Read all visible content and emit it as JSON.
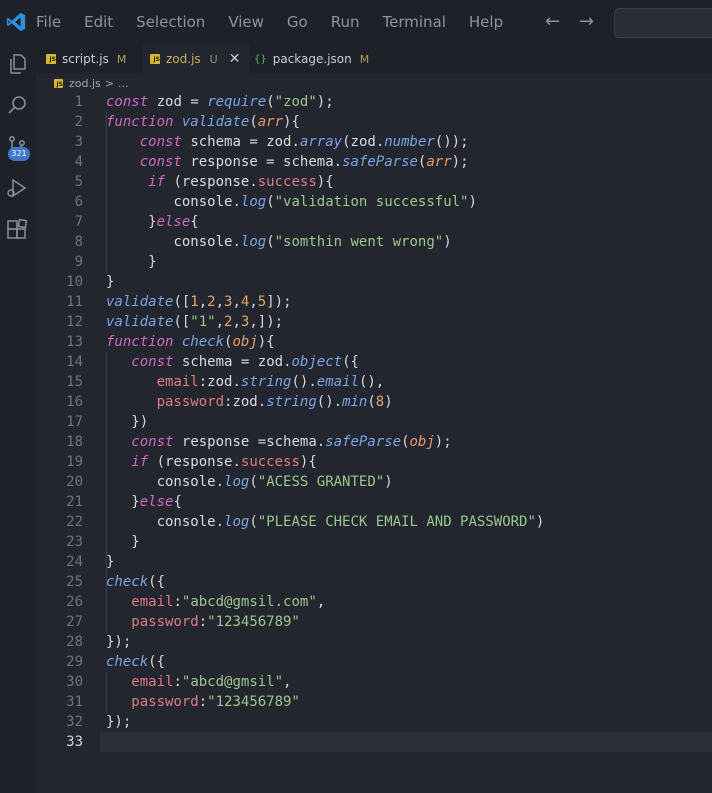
{
  "menu": [
    "File",
    "Edit",
    "Selection",
    "View",
    "Go",
    "Run",
    "Terminal",
    "Help"
  ],
  "tabs": [
    {
      "name": "script.js",
      "status": "M"
    },
    {
      "name": "zod.js",
      "status": "U",
      "active": true
    },
    {
      "name": "package.json",
      "status": "M"
    }
  ],
  "icons": {
    "tab_js": "JS",
    "tab_package": "{}"
  },
  "breadcrumb": {
    "file": "zod.js",
    "sep": ">",
    "rest": "..."
  },
  "source_control_badge": "321",
  "current_line": 33,
  "lines": [
    [
      [
        "k",
        "const"
      ],
      [
        "pn",
        " "
      ],
      [
        "id",
        "zod"
      ],
      [
        "pn",
        " = "
      ],
      [
        "fn",
        "require"
      ],
      [
        "pn",
        "("
      ],
      [
        "str",
        "\"zod\""
      ],
      [
        "pn",
        ");"
      ]
    ],
    [
      [
        "k",
        "function"
      ],
      [
        "pn",
        " "
      ],
      [
        "fn",
        "validate"
      ],
      [
        "pn",
        "("
      ],
      [
        "pm",
        "arr"
      ],
      [
        "pn",
        "){"
      ]
    ],
    [
      [
        "pn",
        "    "
      ],
      [
        "k",
        "const"
      ],
      [
        "pn",
        " "
      ],
      [
        "id",
        "schema"
      ],
      [
        "pn",
        " = "
      ],
      [
        "id",
        "zod"
      ],
      [
        "pn",
        "."
      ],
      [
        "fn",
        "array"
      ],
      [
        "pn",
        "("
      ],
      [
        "id",
        "zod"
      ],
      [
        "pn",
        "."
      ],
      [
        "fn",
        "number"
      ],
      [
        "pn",
        "());"
      ]
    ],
    [
      [
        "pn",
        "    "
      ],
      [
        "k",
        "const"
      ],
      [
        "pn",
        " "
      ],
      [
        "id",
        "response"
      ],
      [
        "pn",
        " = "
      ],
      [
        "id",
        "schema"
      ],
      [
        "pn",
        "."
      ],
      [
        "fn",
        "safeParse"
      ],
      [
        "pn",
        "("
      ],
      [
        "pm",
        "arr"
      ],
      [
        "pn",
        ");"
      ]
    ],
    [
      [
        "pn",
        "     "
      ],
      [
        "k",
        "if"
      ],
      [
        "pn",
        " ("
      ],
      [
        "id",
        "response"
      ],
      [
        "pn",
        "."
      ],
      [
        "prop",
        "success"
      ],
      [
        "pn",
        "){"
      ]
    ],
    [
      [
        "pn",
        "        "
      ],
      [
        "id",
        "console"
      ],
      [
        "pn",
        "."
      ],
      [
        "fn",
        "log"
      ],
      [
        "pn",
        "("
      ],
      [
        "str",
        "\"validation successful\""
      ],
      [
        "pn",
        ")"
      ]
    ],
    [
      [
        "pn",
        "     }"
      ],
      [
        "k",
        "else"
      ],
      [
        "pn",
        "{"
      ]
    ],
    [
      [
        "pn",
        "        "
      ],
      [
        "id",
        "console"
      ],
      [
        "pn",
        "."
      ],
      [
        "fn",
        "log"
      ],
      [
        "pn",
        "("
      ],
      [
        "str",
        "\"somthin went wrong\""
      ],
      [
        "pn",
        ")"
      ]
    ],
    [
      [
        "pn",
        "     }"
      ]
    ],
    [
      [
        "pn",
        "}"
      ]
    ],
    [
      [
        "fn",
        "validate"
      ],
      [
        "pn",
        "(["
      ],
      [
        "num",
        "1"
      ],
      [
        "pn",
        ","
      ],
      [
        "num",
        "2"
      ],
      [
        "pn",
        ","
      ],
      [
        "num",
        "3"
      ],
      [
        "pn",
        ","
      ],
      [
        "num",
        "4"
      ],
      [
        "pn",
        ","
      ],
      [
        "num",
        "5"
      ],
      [
        "pn",
        "]);"
      ]
    ],
    [
      [
        "fn",
        "validate"
      ],
      [
        "pn",
        "(["
      ],
      [
        "str",
        "\"1\""
      ],
      [
        "pn",
        ","
      ],
      [
        "num",
        "2"
      ],
      [
        "pn",
        ","
      ],
      [
        "num",
        "3"
      ],
      [
        "pn",
        ",]);"
      ]
    ],
    [
      [
        "k",
        "function"
      ],
      [
        "pn",
        " "
      ],
      [
        "fn",
        "check"
      ],
      [
        "pn",
        "("
      ],
      [
        "pm",
        "obj"
      ],
      [
        "pn",
        "){"
      ]
    ],
    [
      [
        "pn",
        "   "
      ],
      [
        "k",
        "const"
      ],
      [
        "pn",
        " "
      ],
      [
        "id",
        "schema"
      ],
      [
        "pn",
        " = "
      ],
      [
        "id",
        "zod"
      ],
      [
        "pn",
        "."
      ],
      [
        "fn",
        "object"
      ],
      [
        "pn",
        "({"
      ]
    ],
    [
      [
        "pn",
        "      "
      ],
      [
        "prop",
        "email"
      ],
      [
        "pn",
        ":"
      ],
      [
        "id",
        "zod"
      ],
      [
        "pn",
        "."
      ],
      [
        "fn",
        "string"
      ],
      [
        "pn",
        "()."
      ],
      [
        "fn",
        "email"
      ],
      [
        "pn",
        "(),"
      ]
    ],
    [
      [
        "pn",
        "      "
      ],
      [
        "prop",
        "password"
      ],
      [
        "pn",
        ":"
      ],
      [
        "id",
        "zod"
      ],
      [
        "pn",
        "."
      ],
      [
        "fn",
        "string"
      ],
      [
        "pn",
        "()."
      ],
      [
        "fn",
        "min"
      ],
      [
        "pn",
        "("
      ],
      [
        "num",
        "8"
      ],
      [
        "pn",
        ")"
      ]
    ],
    [
      [
        "pn",
        "   })"
      ]
    ],
    [
      [
        "pn",
        "   "
      ],
      [
        "k",
        "const"
      ],
      [
        "pn",
        " "
      ],
      [
        "id",
        "response"
      ],
      [
        "pn",
        " ="
      ],
      [
        "id",
        "schema"
      ],
      [
        "pn",
        "."
      ],
      [
        "fn",
        "safeParse"
      ],
      [
        "pn",
        "("
      ],
      [
        "pm",
        "obj"
      ],
      [
        "pn",
        ");"
      ]
    ],
    [
      [
        "pn",
        "   "
      ],
      [
        "k",
        "if"
      ],
      [
        "pn",
        " ("
      ],
      [
        "id",
        "response"
      ],
      [
        "pn",
        "."
      ],
      [
        "prop",
        "success"
      ],
      [
        "pn",
        "){"
      ]
    ],
    [
      [
        "pn",
        "      "
      ],
      [
        "id",
        "console"
      ],
      [
        "pn",
        "."
      ],
      [
        "fn",
        "log"
      ],
      [
        "pn",
        "("
      ],
      [
        "str",
        "\"ACESS GRANTED\""
      ],
      [
        "pn",
        ")"
      ]
    ],
    [
      [
        "pn",
        "   }"
      ],
      [
        "k",
        "else"
      ],
      [
        "pn",
        "{"
      ]
    ],
    [
      [
        "pn",
        "      "
      ],
      [
        "id",
        "console"
      ],
      [
        "pn",
        "."
      ],
      [
        "fn",
        "log"
      ],
      [
        "pn",
        "("
      ],
      [
        "str",
        "\"PLEASE CHECK EMAIL AND PASSWORD\""
      ],
      [
        "pn",
        ")"
      ]
    ],
    [
      [
        "pn",
        "   }"
      ]
    ],
    [
      [
        "pn",
        "}"
      ]
    ],
    [
      [
        "fn",
        "check"
      ],
      [
        "pn",
        "({"
      ]
    ],
    [
      [
        "pn",
        "   "
      ],
      [
        "prop",
        "email"
      ],
      [
        "pn",
        ":"
      ],
      [
        "str",
        "\"abcd@gmsil.com\""
      ],
      [
        "pn",
        ","
      ]
    ],
    [
      [
        "pn",
        "   "
      ],
      [
        "prop",
        "password"
      ],
      [
        "pn",
        ":"
      ],
      [
        "str",
        "\"123456789\""
      ]
    ],
    [
      [
        "pn",
        "});"
      ]
    ],
    [
      [
        "fn",
        "check"
      ],
      [
        "pn",
        "({"
      ]
    ],
    [
      [
        "pn",
        "   "
      ],
      [
        "prop",
        "email"
      ],
      [
        "pn",
        ":"
      ],
      [
        "str",
        "\"abcd@gmsil\""
      ],
      [
        "pn",
        ","
      ]
    ],
    [
      [
        "pn",
        "   "
      ],
      [
        "prop",
        "password"
      ],
      [
        "pn",
        ":"
      ],
      [
        "str",
        "\"123456789\""
      ]
    ],
    [
      [
        "pn",
        "});"
      ]
    ],
    []
  ]
}
